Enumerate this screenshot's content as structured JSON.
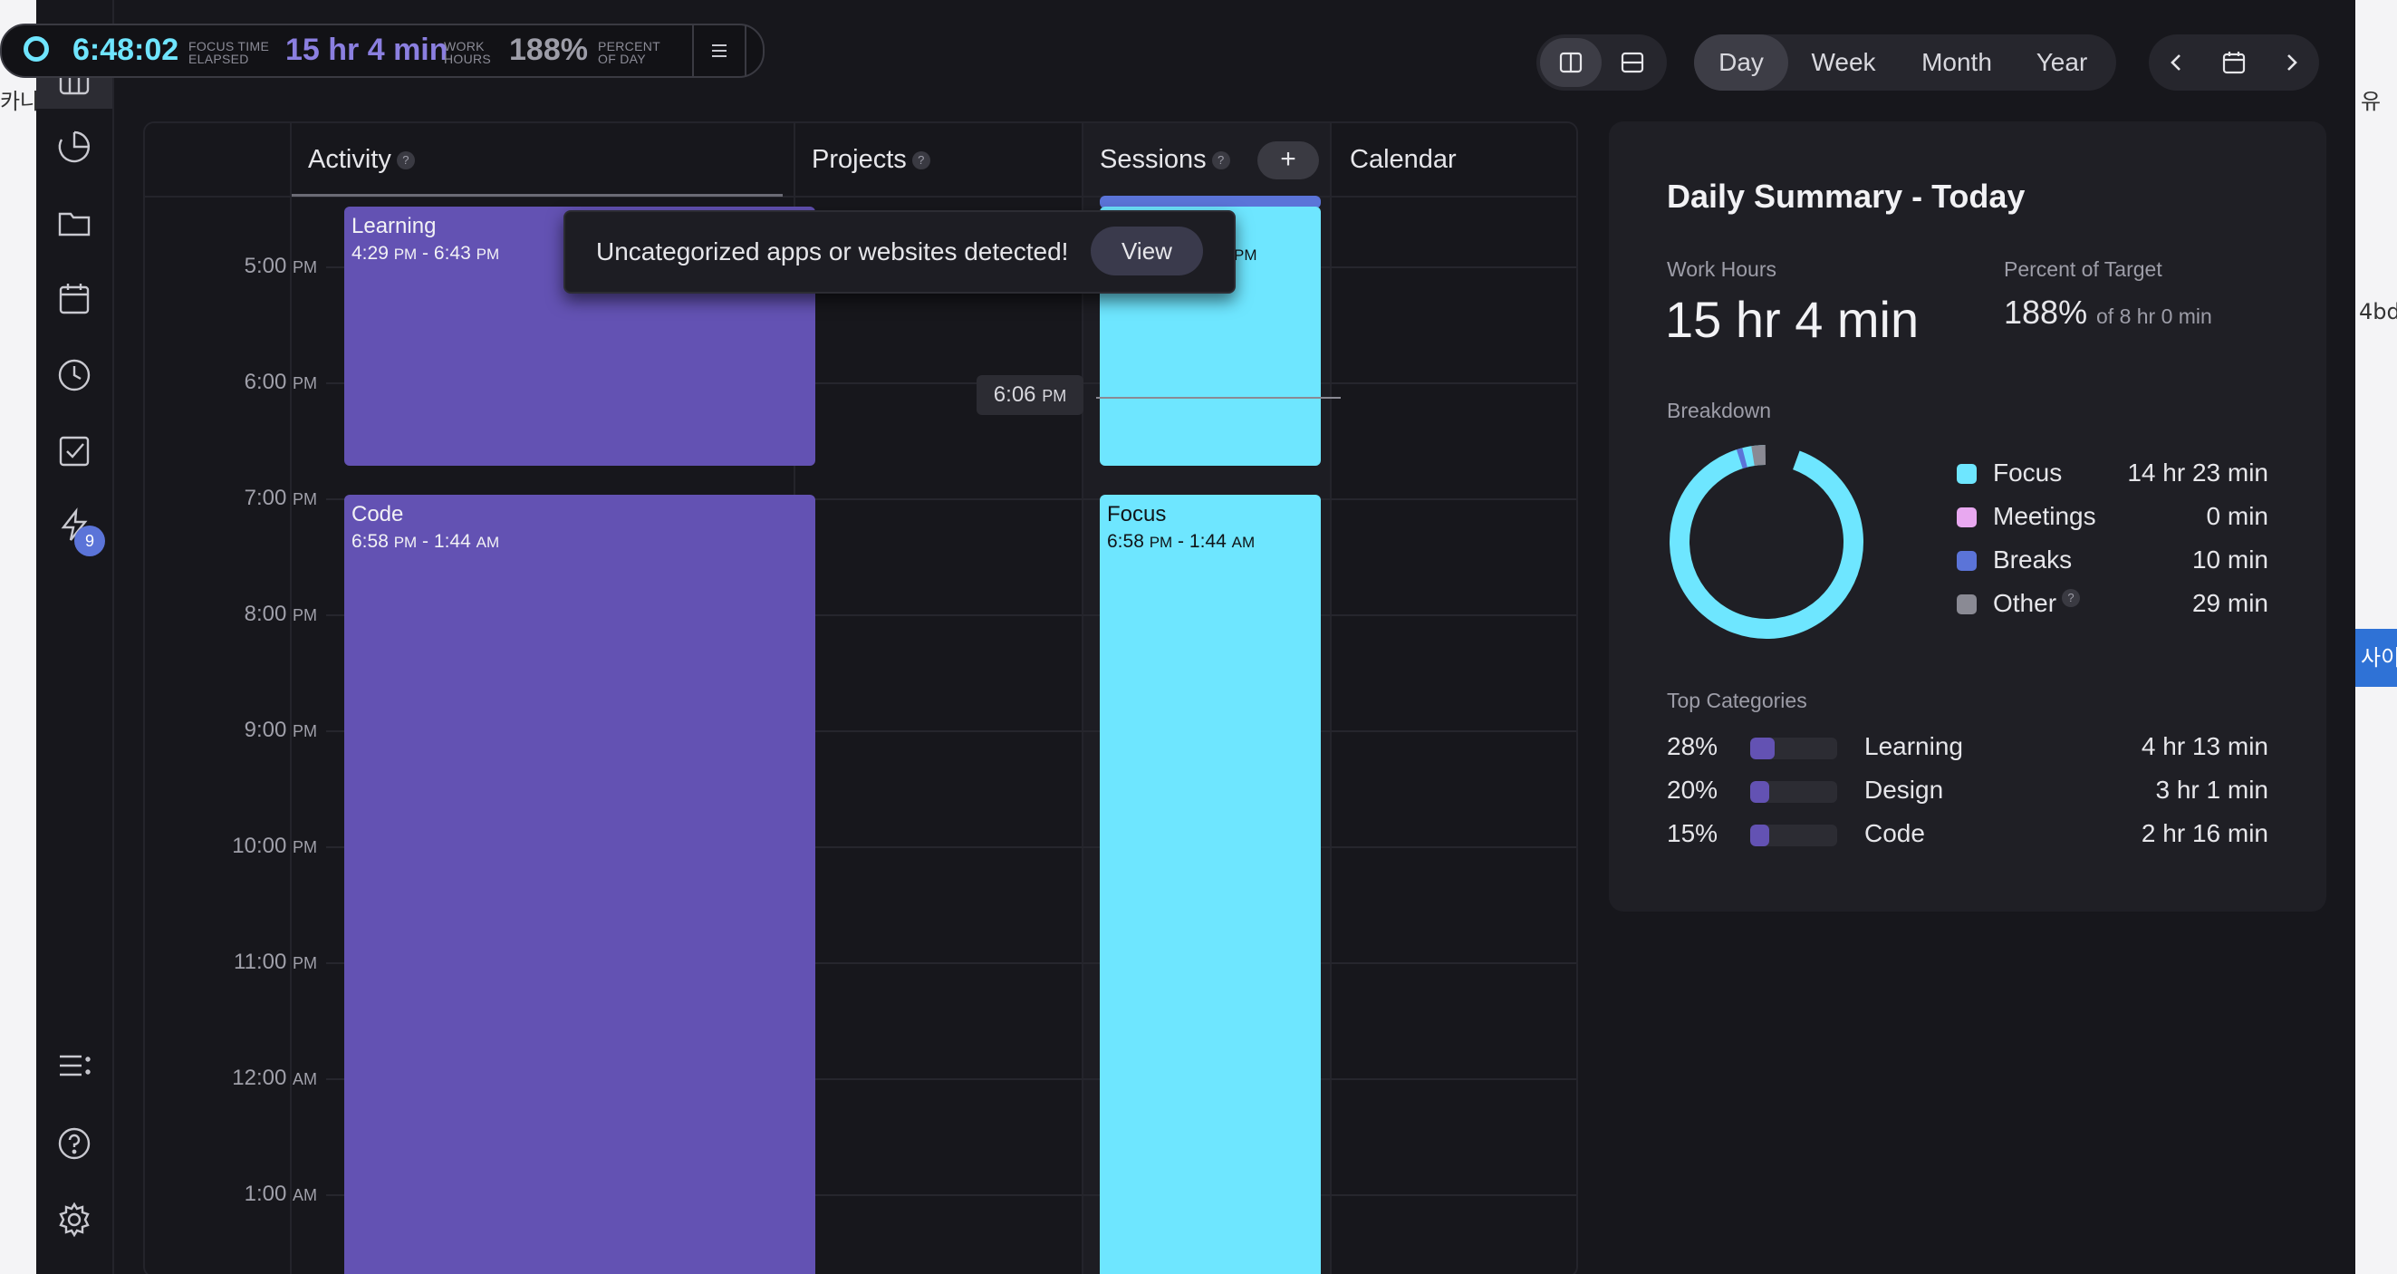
{
  "background": {
    "left_text": "카나",
    "right_text_1": "유",
    "right_text_2": "4bd",
    "right_text_3": "사이"
  },
  "timer": {
    "elapsed": "6:48:02",
    "elapsed_label_1": "FOCUS TIME",
    "elapsed_label_2": "ELAPSED",
    "work_hours": "15 hr 4 min",
    "work_label_1": "WORK",
    "work_label_2": "HOURS",
    "percent": "188%",
    "percent_label_1": "PERCENT",
    "percent_label_2": "OF DAY"
  },
  "sidebar": {
    "badge_count": "9",
    "items": [
      "dashboard-icon",
      "pie-chart-icon",
      "folder-icon",
      "calendar-icon",
      "clock-icon",
      "checkbox-icon",
      "lightning-icon",
      "list-icon",
      "help-icon",
      "settings-icon"
    ]
  },
  "toolbar": {
    "ranges": [
      "Day",
      "Week",
      "Month",
      "Year"
    ],
    "active_range": "Day"
  },
  "calendar": {
    "columns": [
      "Activity",
      "Projects",
      "Sessions",
      "Calendar"
    ],
    "add_label": "+",
    "time_labels": [
      {
        "time": "5:00",
        "ap": "PM"
      },
      {
        "time": "6:00",
        "ap": "PM"
      },
      {
        "time": "7:00",
        "ap": "PM"
      },
      {
        "time": "8:00",
        "ap": "PM"
      },
      {
        "time": "9:00",
        "ap": "PM"
      },
      {
        "time": "10:00",
        "ap": "PM"
      },
      {
        "time": "11:00",
        "ap": "PM"
      },
      {
        "time": "12:00",
        "ap": "AM"
      },
      {
        "time": "1:00",
        "ap": "AM"
      }
    ],
    "now": {
      "time": "6:06",
      "ap": "PM"
    },
    "activity_blocks": [
      {
        "title": "Learning",
        "start": "4:29",
        "start_ap": "PM",
        "end": "6:43",
        "end_ap": "PM"
      },
      {
        "title": "Code",
        "start": "6:58",
        "start_ap": "PM",
        "end": "1:44",
        "end_ap": "AM"
      }
    ],
    "session_blocks": [
      {
        "title": "",
        "partial_text": "PM"
      },
      {
        "title": "Focus",
        "start": "6:58",
        "start_ap": "PM",
        "end": "1:44",
        "end_ap": "AM"
      }
    ]
  },
  "toast": {
    "message": "Uncategorized apps or websites detected!",
    "button": "View"
  },
  "summary": {
    "title": "Daily Summary - Today",
    "work_hours_label": "Work Hours",
    "work_hours": "15 hr 4 min",
    "percent_label": "Percent of Target",
    "percent": "188%",
    "percent_of": "of 8 hr 0 min",
    "breakdown_label": "Breakdown",
    "breakdown": [
      {
        "name": "Focus",
        "value": "14 hr 23 min",
        "color": "#6ee6ff"
      },
      {
        "name": "Meetings",
        "value": "0 min",
        "color": "#e8a8f0"
      },
      {
        "name": "Breaks",
        "value": "10 min",
        "color": "#5b74d8"
      },
      {
        "name": "Other",
        "value": "29 min",
        "color": "#8a8a94"
      }
    ],
    "top_categories_label": "Top Categories",
    "categories": [
      {
        "pct": "28%",
        "fill": 0.28,
        "name": "Learning",
        "value": "4 hr 13 min"
      },
      {
        "pct": "20%",
        "fill": 0.2,
        "name": "Design",
        "value": "3 hr 1 min"
      },
      {
        "pct": "15%",
        "fill": 0.15,
        "name": "Code",
        "value": "2 hr 16 min"
      }
    ]
  }
}
